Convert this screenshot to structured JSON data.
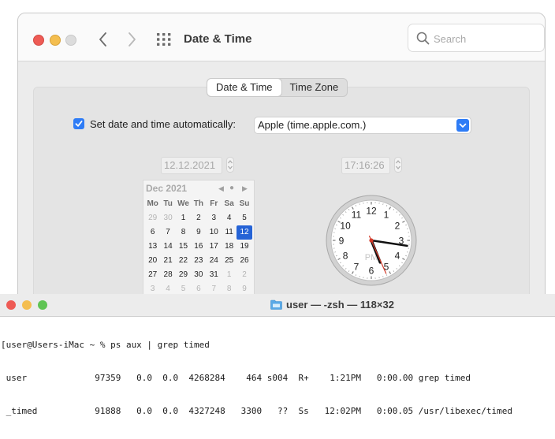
{
  "prefs_window": {
    "title": "Date & Time",
    "search_placeholder": "Search",
    "tabs": [
      {
        "label": "Date & Time",
        "active": true
      },
      {
        "label": "Time Zone",
        "active": false
      }
    ],
    "auto_set_label": "Set date and time automatically:",
    "auto_set_checked": true,
    "time_server": "Apple (time.apple.com.)",
    "date_value": "12.12.2021",
    "time_value": "17:16:26",
    "calendar": {
      "month_label": "Dec 2021",
      "weekdays": [
        "Mo",
        "Tu",
        "We",
        "Th",
        "Fr",
        "Sa",
        "Su"
      ],
      "weeks": [
        [
          "29",
          "30",
          "1",
          "2",
          "3",
          "4",
          "5"
        ],
        [
          "6",
          "7",
          "8",
          "9",
          "10",
          "11",
          "12"
        ],
        [
          "13",
          "14",
          "15",
          "16",
          "17",
          "18",
          "19"
        ],
        [
          "20",
          "21",
          "22",
          "23",
          "24",
          "25",
          "26"
        ],
        [
          "27",
          "28",
          "29",
          "30",
          "31",
          "1",
          "2"
        ],
        [
          "3",
          "4",
          "5",
          "6",
          "7",
          "8",
          "9"
        ]
      ],
      "selected_day": "12"
    },
    "clock": {
      "numerals": [
        "12",
        "1",
        "2",
        "3",
        "4",
        "5",
        "6",
        "7",
        "8",
        "9",
        "10",
        "11"
      ],
      "meridiem": "PM",
      "hour": 17,
      "minute": 16,
      "second": 26
    }
  },
  "terminal": {
    "title": "user — -zsh — 118×32",
    "lines": [
      "[user@Users-iMac ~ % ps aux | grep timed",
      " user             97359   0.0  0.0  4268284    464 s004  R+    1:21PM   0:00.00 grep timed",
      " _timed           91888   0.0  0.0  4327248   3300   ??  Ss   12:02PM   0:00.05 /usr/libexec/timed"
    ]
  },
  "colors": {
    "accent": "#2e7cf6",
    "selected_day": "#2563d6",
    "close": "#ee5b55",
    "minimize": "#f4be4f",
    "zoom": "#5fc454"
  },
  "icons": [
    "chevron-left-icon",
    "chevron-right-icon",
    "grid-icon",
    "search-icon",
    "checkmark-icon",
    "chevron-updown-icon",
    "folder-icon"
  ]
}
